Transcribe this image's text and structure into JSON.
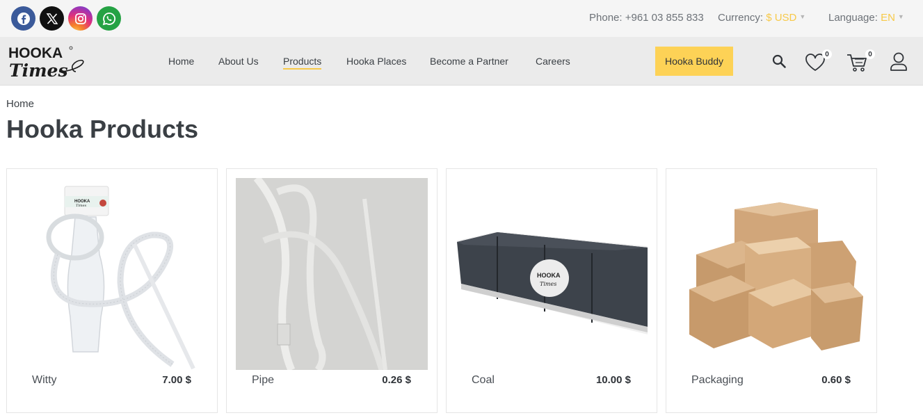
{
  "topbar": {
    "social": [
      "facebook-icon",
      "x-icon",
      "instagram-icon",
      "whatsapp-icon"
    ],
    "phone_label": "Phone:",
    "phone_value": "+961 03 855 833",
    "currency_label": "Currency:",
    "currency_value": "$ USD",
    "language_label": "Language:",
    "language_value": "EN",
    "accent_color": "#f7c948"
  },
  "logo": {
    "line1": "HOOKA",
    "line2": "Times"
  },
  "nav": {
    "items": [
      {
        "label": "Home"
      },
      {
        "label": "About Us"
      },
      {
        "label": "Products",
        "active": true
      },
      {
        "label": "Hooka Places"
      },
      {
        "label": "Become a Partner"
      },
      {
        "label": "Careers"
      }
    ],
    "cta_label": "Hooka Buddy",
    "wishlist_count": "0",
    "cart_count": "0"
  },
  "breadcrumb": "Home",
  "page_title": "Hooka Products",
  "products": [
    {
      "name": "Witty",
      "price": "7.00 $",
      "logo_line1": "HOOKA",
      "logo_line2": "Times"
    },
    {
      "name": "Pipe",
      "price": "0.26 $"
    },
    {
      "name": "Coal",
      "price": "10.00 $",
      "logo_line1": "HOOKA",
      "logo_line2": "Times"
    },
    {
      "name": "Packaging",
      "price": "0.60 $"
    }
  ]
}
